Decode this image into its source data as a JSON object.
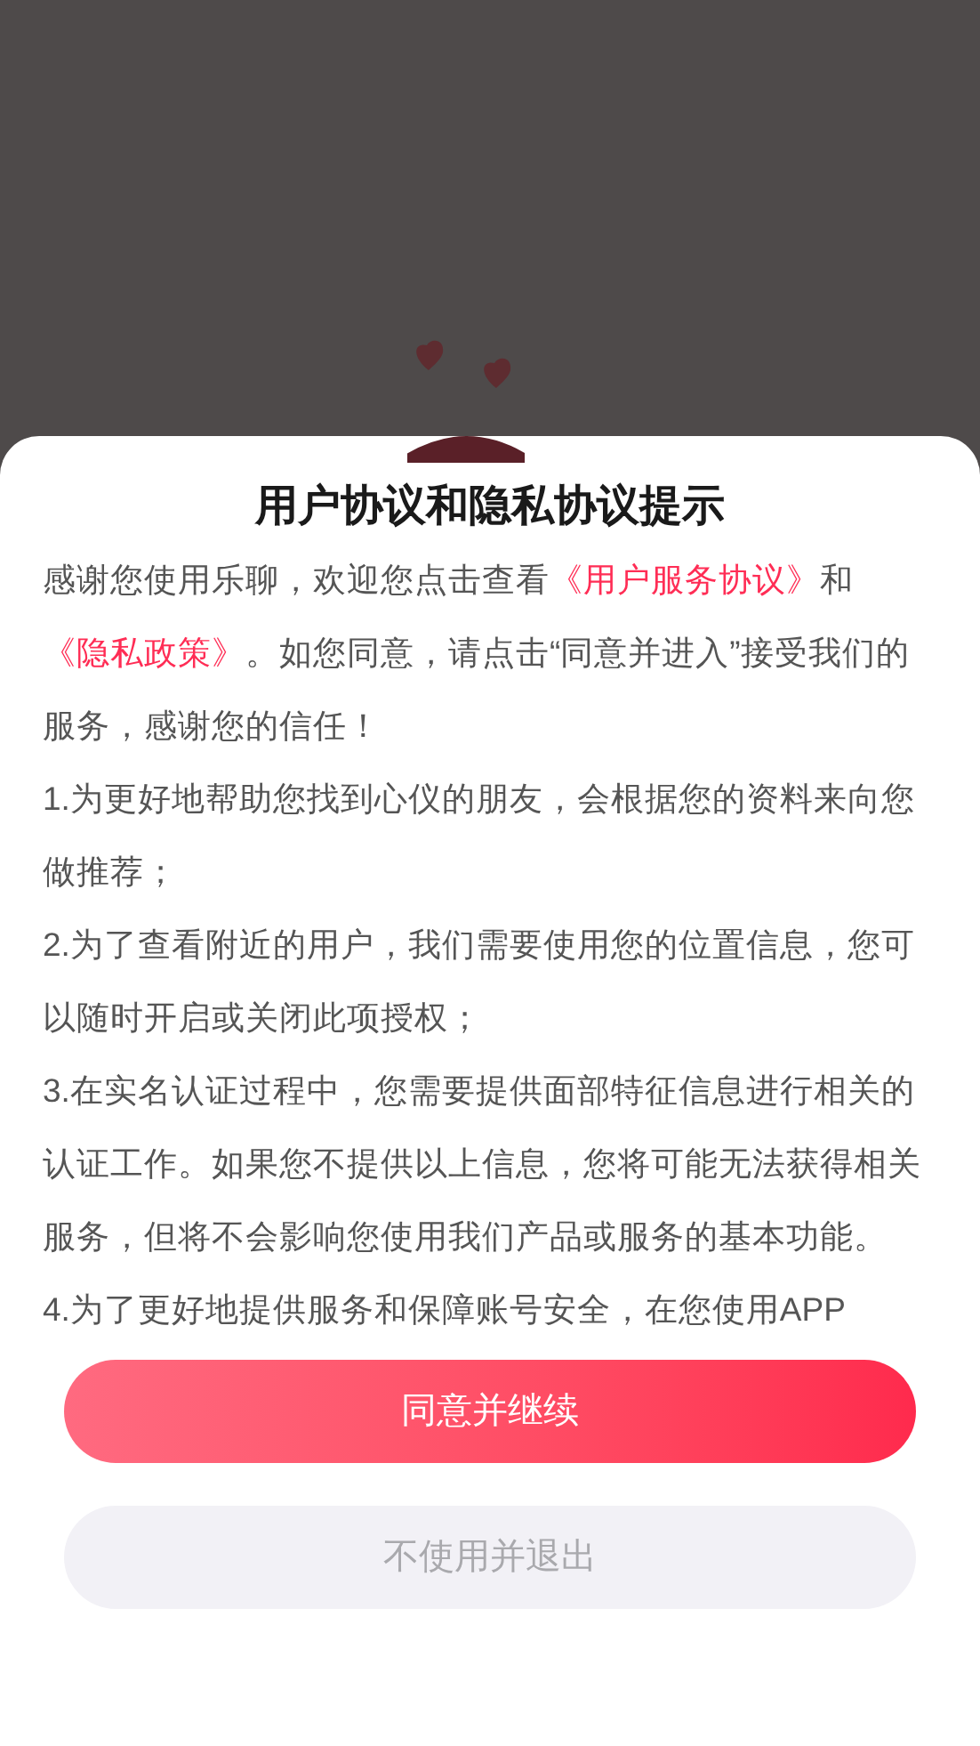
{
  "dialog": {
    "title": "用户协议和隐私协议提示",
    "paragraphs": [
      {
        "parts": [
          {
            "kind": "plain",
            "text": "感谢您使用乐聊，欢迎您点击查看"
          },
          {
            "kind": "link",
            "text": "《用户服务协议》"
          },
          {
            "kind": "plain",
            "text": "和"
          },
          {
            "kind": "link",
            "text": "《隐私政策》"
          },
          {
            "kind": "plain",
            "text": "。如您同意，请点击“同意并进入”接受我们的服务，感谢您的信任！"
          }
        ]
      },
      {
        "parts": [
          {
            "kind": "plain",
            "text": "1.为更好地帮助您找到心仪的朋友，会根据您的资料来向您做推荐；"
          }
        ]
      },
      {
        "parts": [
          {
            "kind": "plain",
            "text": "2.为了查看附近的用户，我们需要使用您的位置信息，您可以随时开启或关闭此项授权；"
          }
        ]
      },
      {
        "parts": [
          {
            "kind": "plain",
            "text": "3.在实名认证过程中，您需要提供面部特征信息进行相关的认证工作。如果您不提供以上信息，您将可能无法获得相关服务，但将不会影响您使用我们产品或服务的基本功能。"
          }
        ]
      },
      {
        "parts": [
          {
            "kind": "plain",
            "text": "4.为了更好地提供服务和保障账号安全，在您使用APP"
          }
        ]
      }
    ],
    "buttons": [
      {
        "kind": "primary",
        "label": "同意并继续"
      },
      {
        "kind": "secondary",
        "label": "不使用并退出"
      }
    ]
  }
}
